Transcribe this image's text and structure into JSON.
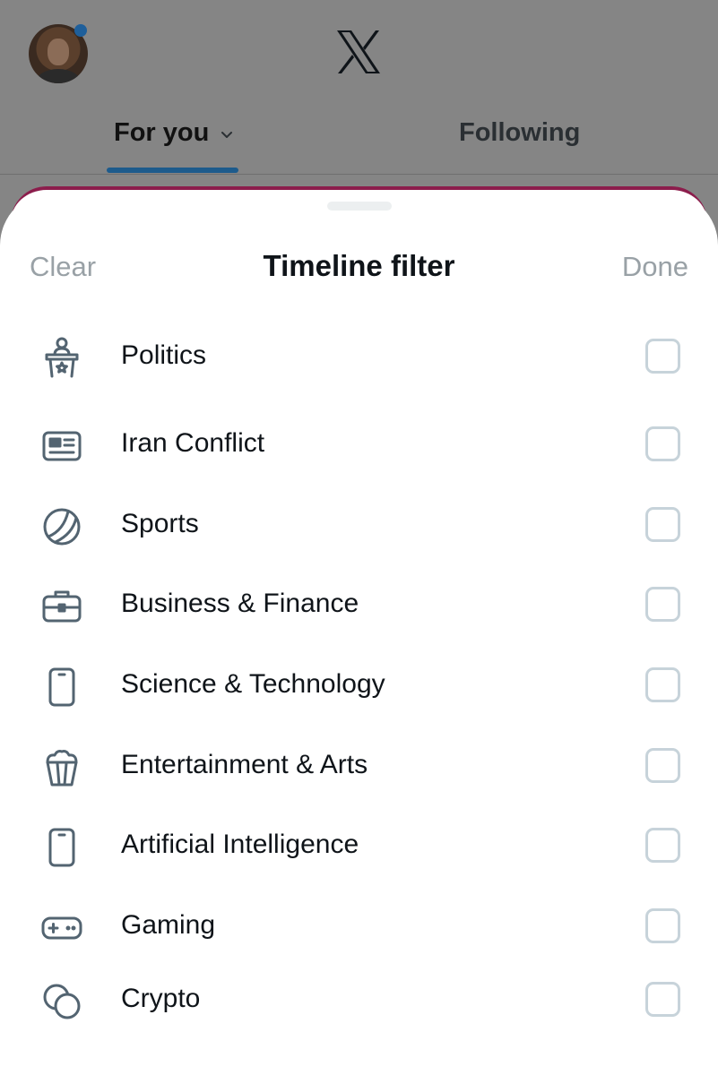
{
  "header": {
    "logo": "x-logo-icon",
    "tabs": [
      {
        "label": "For you",
        "active": true
      },
      {
        "label": "Following",
        "active": false
      }
    ]
  },
  "sheet": {
    "title": "Timeline filter",
    "clear_label": "Clear",
    "done_label": "Done",
    "items": [
      {
        "label": "Politics",
        "icon": "politics-podium-icon",
        "checked": false
      },
      {
        "label": "Iran Conflict",
        "icon": "newspaper-icon",
        "checked": false
      },
      {
        "label": "Sports",
        "icon": "tennis-ball-icon",
        "checked": false
      },
      {
        "label": "Business & Finance",
        "icon": "briefcase-icon",
        "checked": false
      },
      {
        "label": "Science & Technology",
        "icon": "phone-icon",
        "checked": false
      },
      {
        "label": "Entertainment & Arts",
        "icon": "popcorn-icon",
        "checked": false
      },
      {
        "label": "Artificial Intelligence",
        "icon": "phone-icon",
        "checked": false
      },
      {
        "label": "Gaming",
        "icon": "gamepad-icon",
        "checked": false
      },
      {
        "label": "Crypto",
        "icon": "coins-icon",
        "checked": false
      }
    ]
  },
  "colors": {
    "accent_underline": "#1d5b8c",
    "notification_dot": "#1e5f9b",
    "icon_stroke": "#536471",
    "checkbox_border": "#c7d3da",
    "muted_button": "#99a1a6"
  }
}
